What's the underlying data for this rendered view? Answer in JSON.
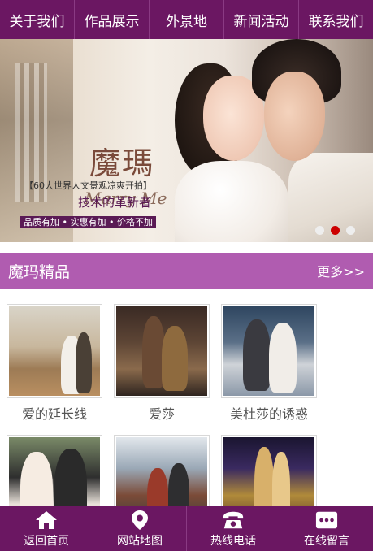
{
  "top_nav": {
    "items": [
      {
        "label": "关于我们"
      },
      {
        "label": "作品展示"
      },
      {
        "label": "外景地"
      },
      {
        "label": "新闻活动"
      },
      {
        "label": "联系我们"
      }
    ]
  },
  "banner": {
    "logo": "魔瑪",
    "subtitle": "Marry Me",
    "promo": "【60大世界人文景观凉爽开拍】",
    "tagline": "技术的革新者",
    "badges": "品质有加 • 实惠有加 • 价格不加",
    "slide_count": 3,
    "active_slide": 2
  },
  "section": {
    "title": "魔玛精品",
    "more": "更多>>"
  },
  "products": [
    {
      "caption": "爱的延长线"
    },
    {
      "caption": "爱莎"
    },
    {
      "caption": "美杜莎的诱惑"
    },
    {
      "caption": ""
    },
    {
      "caption": ""
    },
    {
      "caption": ""
    }
  ],
  "bottom_nav": {
    "items": [
      {
        "label": "返回首页",
        "icon": "home-icon"
      },
      {
        "label": "网站地图",
        "icon": "map-pin-icon"
      },
      {
        "label": "热线电话",
        "icon": "phone-icon"
      },
      {
        "label": "在线留言",
        "icon": "message-icon"
      }
    ]
  },
  "colors": {
    "nav_bg": "#6b1762",
    "section_bg": "#b05cb0",
    "active_dot": "#cc0000"
  }
}
